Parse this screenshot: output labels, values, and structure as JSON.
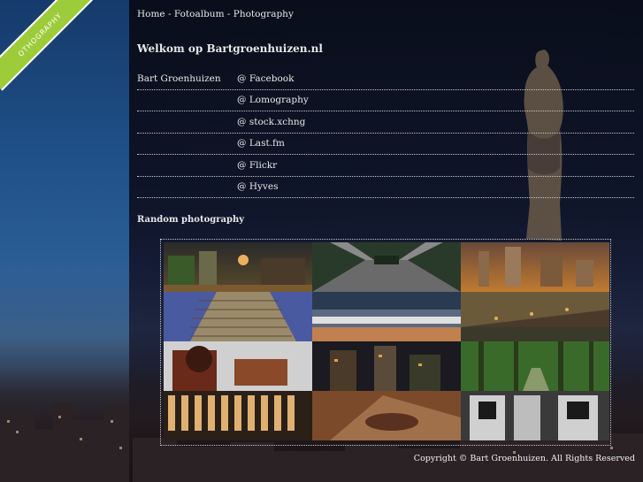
{
  "breadcrumb": {
    "home": "Home",
    "sep1": " - ",
    "fotoalbum": "Fotoalbum",
    "sep2": " - ",
    "photography": "Photography"
  },
  "ribbon": {
    "text": "OTHOGRAPHY"
  },
  "welcome_title": "Welkom op Bartgroenhuizen.nl",
  "owner_name": "Bart Groenhuizen",
  "links": [
    "@ Facebook",
    "@ Lomography",
    "@ stock.xchng",
    "@ Last.fm",
    "@ Flickr",
    "@ Hyves"
  ],
  "random_title": "Random photography",
  "gallery_icons": [
    "city-night-photo",
    "bridge-walkway-photo",
    "city-skyline-dusk-photo",
    "office-tower-photo",
    "station-interior-photo",
    "building-perspective-photo",
    "tree-sculpture-photo",
    "city-lights-night-photo",
    "forest-path-photo",
    "lit-facade-photo",
    "rusty-surface-photo",
    "train-doors-photo"
  ],
  "copyright": "Copyright © Bart Groenhuizen. All Rights Reserved",
  "colors": {
    "ribbon": "#9ccc3a",
    "text": "#e8e8e8",
    "background": "#0b1222"
  }
}
